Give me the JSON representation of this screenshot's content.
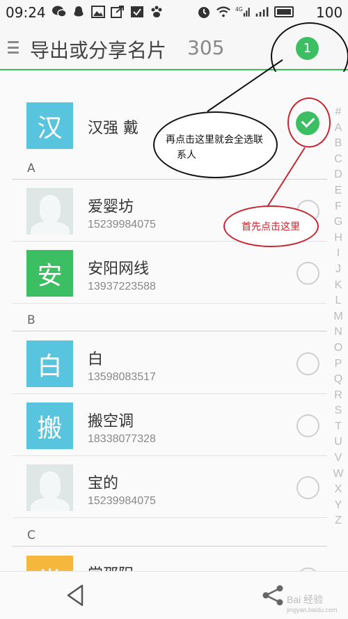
{
  "status_bar": {
    "time": "09:24",
    "battery_percent": "100",
    "left_icons": [
      "wechat-icon",
      "qq-icon",
      "image-icon",
      "share-out-icon",
      "task-check-icon",
      "baidu-paw-icon"
    ],
    "right_icons": [
      "alarm-icon",
      "wifi-icon",
      "signal-4g-icon",
      "signal-icon",
      "battery-icon"
    ],
    "network_label": "4G"
  },
  "app_bar": {
    "title": "导出或分享名片",
    "count": "305",
    "selected_badge": "1",
    "accent_color": "#3cbf62"
  },
  "contacts": {
    "pinned": {
      "avatar_char": "汉",
      "name": "汉强 戴",
      "checked": true
    },
    "sections": [
      {
        "letter": "A",
        "items": [
          {
            "avatar_char": "",
            "avatar_type": "photo",
            "name": "爱婴坊",
            "phone": "15239984075"
          },
          {
            "avatar_char": "安",
            "avatar_type": "green",
            "name": "安阳网线",
            "phone": "13937223588"
          }
        ]
      },
      {
        "letter": "B",
        "items": [
          {
            "avatar_char": "白",
            "avatar_type": "blue",
            "name": "白",
            "phone": "13598083517"
          },
          {
            "avatar_char": "搬",
            "avatar_type": "blue",
            "name": "搬空调",
            "phone": "18338077328"
          },
          {
            "avatar_char": "",
            "avatar_type": "photo",
            "name": "宝的",
            "phone": "15239984075"
          }
        ]
      },
      {
        "letter": "C",
        "items": [
          {
            "avatar_char": "常",
            "avatar_type": "orange",
            "name": "常邵阳",
            "phone": ""
          }
        ]
      }
    ]
  },
  "alphabet_index": [
    "#",
    "A",
    "B",
    "C",
    "D",
    "E",
    "F",
    "G",
    "H",
    "I",
    "J",
    "K",
    "L",
    "M",
    "N",
    "O",
    "P",
    "Q",
    "R",
    "S",
    "T",
    "U",
    "V",
    "W",
    "X",
    "Y",
    "Z"
  ],
  "annotations": {
    "black_note_line1": "再点击这里就会全选联",
    "black_note_line2": "系人",
    "red_note": "首先点击这里"
  },
  "bottom_bar": {
    "watermark": "Bai 经验",
    "watermark_sub": "jingyan.baidu.com"
  }
}
